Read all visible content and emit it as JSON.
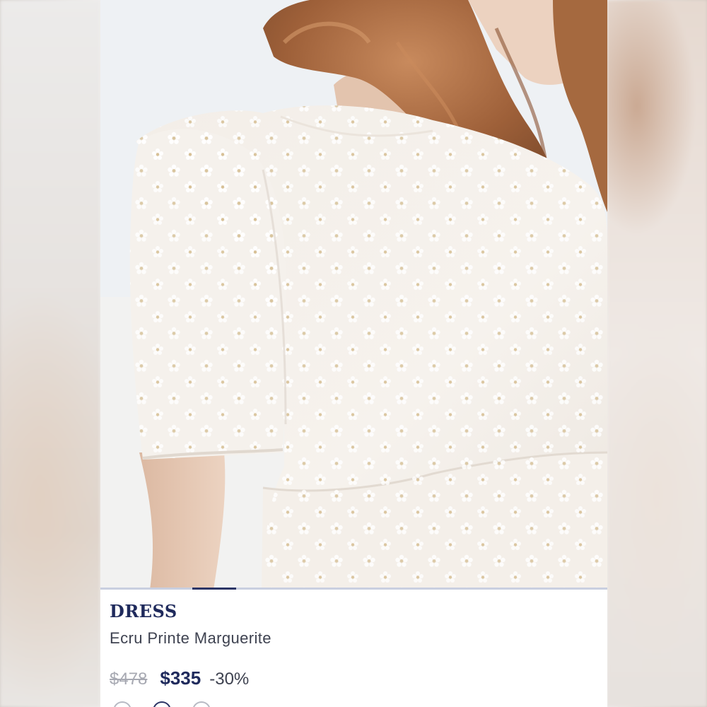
{
  "product": {
    "category": "DRESS",
    "name": "Ecru Printe Marguerite",
    "price_original": "$478",
    "price_sale": "$335",
    "discount": "-30%",
    "image_alt": "white dress with embroidered daisies"
  },
  "carousel": {
    "active_index": 2
  },
  "colors": {
    "brand_navy": "#1f2a5c",
    "muted_text": "#a7a9b2",
    "dress": "#f7f3ee",
    "hair": "#a8683f",
    "skin": "#e8cbb6"
  },
  "icons": {
    "swatches": [
      "color-swatch-icon",
      "color-swatch-icon",
      "color-swatch-icon"
    ]
  }
}
